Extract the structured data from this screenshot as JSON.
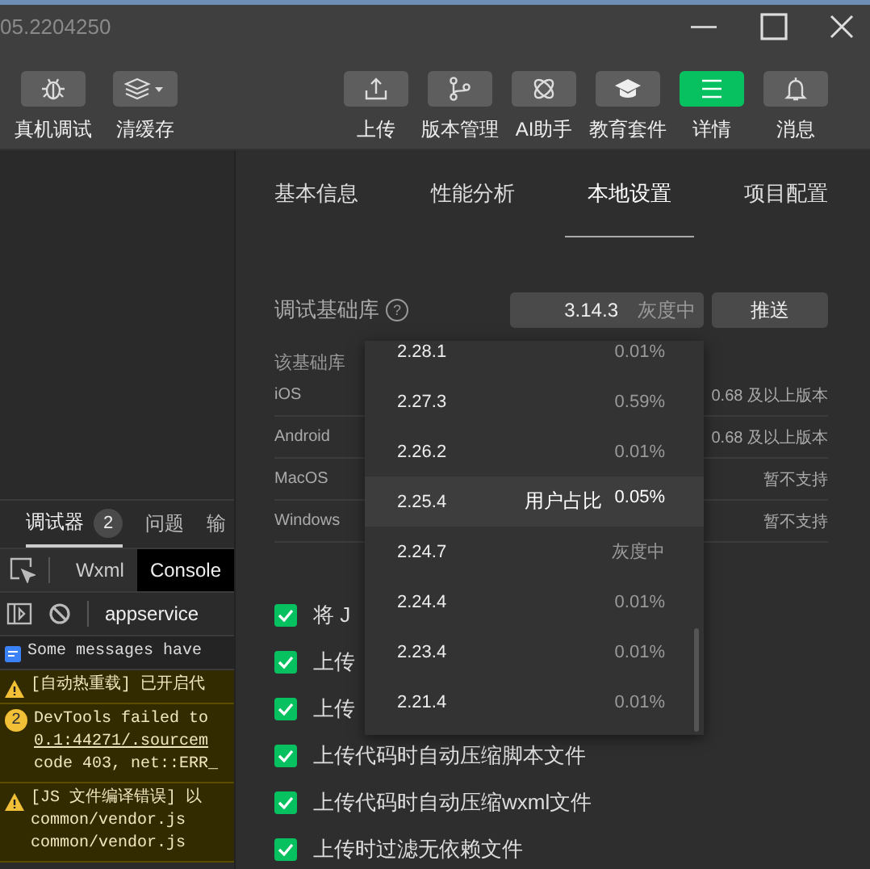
{
  "window": {
    "title": "05.2204250"
  },
  "toolbar": {
    "left": [
      {
        "label": "真机调试",
        "selected": false
      },
      {
        "label": "清缓存",
        "selected": false
      }
    ],
    "right": [
      {
        "label": "上传",
        "selected": false
      },
      {
        "label": "版本管理",
        "selected": false
      },
      {
        "label": "AI助手",
        "selected": false
      },
      {
        "label": "教育套件",
        "selected": false
      },
      {
        "label": "详情",
        "selected": true
      },
      {
        "label": "消息",
        "selected": false
      }
    ]
  },
  "debugger": {
    "tabs": [
      {
        "label": "调试器",
        "badge": "2",
        "selected": true
      },
      {
        "label": "问题",
        "selected": false
      },
      {
        "label": "输",
        "selected": false
      }
    ],
    "panels": [
      {
        "label": "Wxml",
        "selected": false
      },
      {
        "label": "Console",
        "selected": true
      }
    ],
    "context": "appservice",
    "messages": [
      {
        "kind": "info",
        "lines": [
          "Some messages have"
        ]
      },
      {
        "kind": "warning",
        "lines": [
          "[自动热重载] 已开启代"
        ]
      },
      {
        "kind": "count",
        "count": "2",
        "lines": [
          "DevTools failed to",
          "0.1:44271/.sourcem",
          "code 403, net::ERR_"
        ]
      },
      {
        "kind": "warning",
        "lines": [
          "[JS 文件编译错误] 以",
          "common/vendor.js",
          "common/vendor.js"
        ]
      }
    ]
  },
  "details": {
    "tabs": [
      {
        "label": "基本信息",
        "selected": false
      },
      {
        "label": "性能分析",
        "selected": false
      },
      {
        "label": "本地设置",
        "selected": true
      },
      {
        "label": "项目配置",
        "selected": false
      }
    ],
    "library": {
      "label": "调试基础库",
      "help": "?",
      "version": "3.14.3",
      "status": "灰度中",
      "push": "推送"
    },
    "support_title": "该基础库",
    "platforms": [
      {
        "name": "iOS",
        "value": "0.68 及以上版本"
      },
      {
        "name": "Android",
        "value": "0.68 及以上版本"
      },
      {
        "name": "MacOS",
        "value": "暂不支持"
      },
      {
        "name": "Windows",
        "value": "暂不支持"
      }
    ],
    "options": [
      {
        "label": "将 J",
        "checked": true
      },
      {
        "label": "上传",
        "checked": true
      },
      {
        "label": "上传",
        "checked": true
      },
      {
        "label": "上传代码时自动压缩脚本文件",
        "checked": true
      },
      {
        "label": "上传代码时自动压缩wxml文件",
        "checked": true
      },
      {
        "label": "上传时过滤无依赖文件",
        "checked": true
      }
    ]
  },
  "version_menu": {
    "items": [
      {
        "version": "2.28.1",
        "share": "0.01%",
        "selected": false
      },
      {
        "version": "2.27.3",
        "share": "0.59%",
        "selected": false
      },
      {
        "version": "2.26.2",
        "share": "0.01%",
        "selected": false
      },
      {
        "version": "2.25.4",
        "share_label": "用户占比",
        "share": "0.05%",
        "selected": true
      },
      {
        "version": "2.24.7",
        "share": "灰度中",
        "selected": false
      },
      {
        "version": "2.24.4",
        "share": "0.01%",
        "selected": false
      },
      {
        "version": "2.23.4",
        "share": "0.01%",
        "selected": false
      },
      {
        "version": "2.21.4",
        "share": "0.01%",
        "selected": false
      }
    ]
  }
}
